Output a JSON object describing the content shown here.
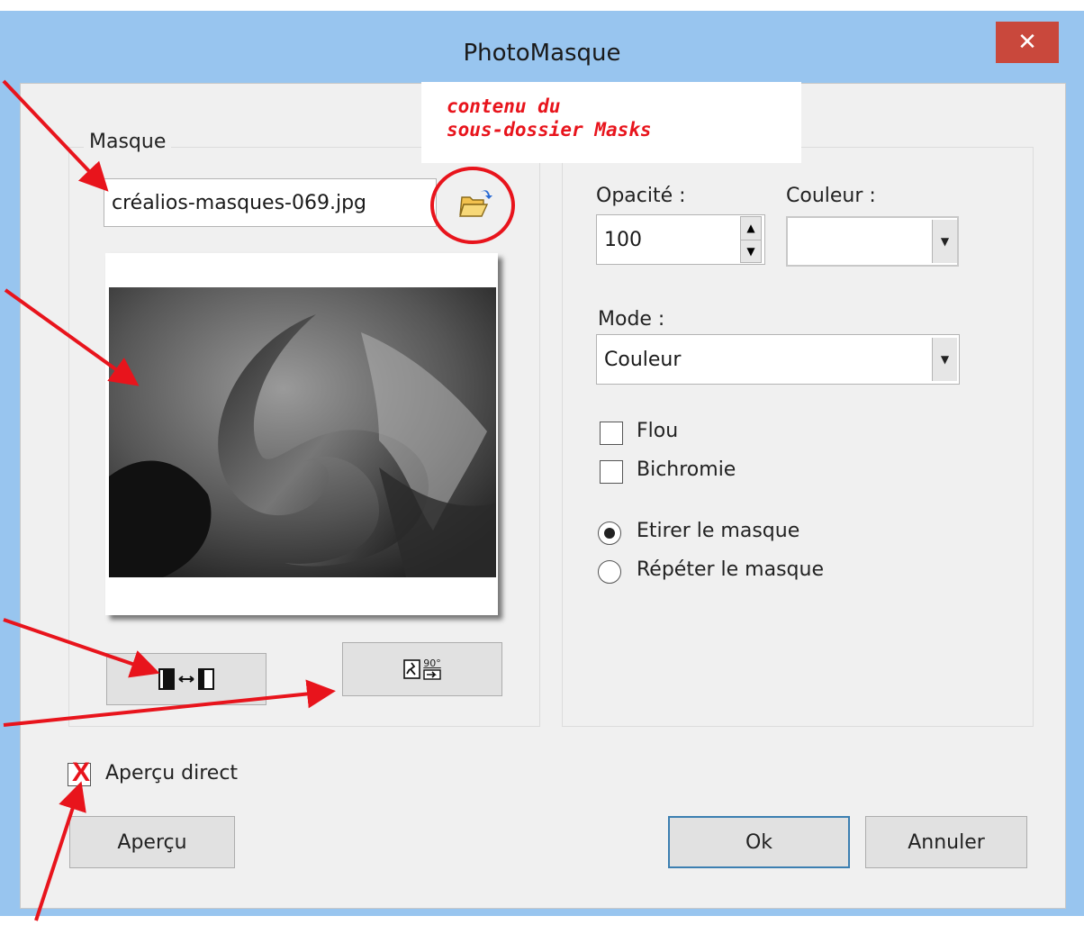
{
  "window": {
    "title": "PhotoMasque",
    "close_glyph": "✕"
  },
  "note": {
    "line1": "contenu du",
    "line2": "sous-dossier Masks"
  },
  "masque": {
    "legend": "Masque",
    "filename": "créalios-masques-069.jpg",
    "open_folder_icon": "open-folder-icon",
    "flip_button_icon": "flip-horizontal-icon",
    "rotate_button_icon": "rotate-90-icon",
    "rotate_label": "90°"
  },
  "options": {
    "opacity_label": "Opacité :",
    "opacity_value": "100",
    "color_label": "Couleur :",
    "mode_label": "Mode :",
    "mode_value": "Couleur",
    "flou_label": "Flou",
    "flou_checked": false,
    "bichromie_label": "Bichromie",
    "bichromie_checked": false,
    "stretch_label": "Etirer le masque",
    "stretch_selected": true,
    "repeat_label": "Répéter le masque",
    "repeat_selected": false
  },
  "apercu_direct": {
    "label": "Aperçu direct",
    "mark": "X",
    "checked": true
  },
  "buttons": {
    "preview": "Aperçu",
    "ok": "Ok",
    "cancel": "Annuler"
  },
  "colors": {
    "annotation_red": "#e8141c",
    "titlebar": "#98c5ef",
    "close": "#c9483c"
  }
}
